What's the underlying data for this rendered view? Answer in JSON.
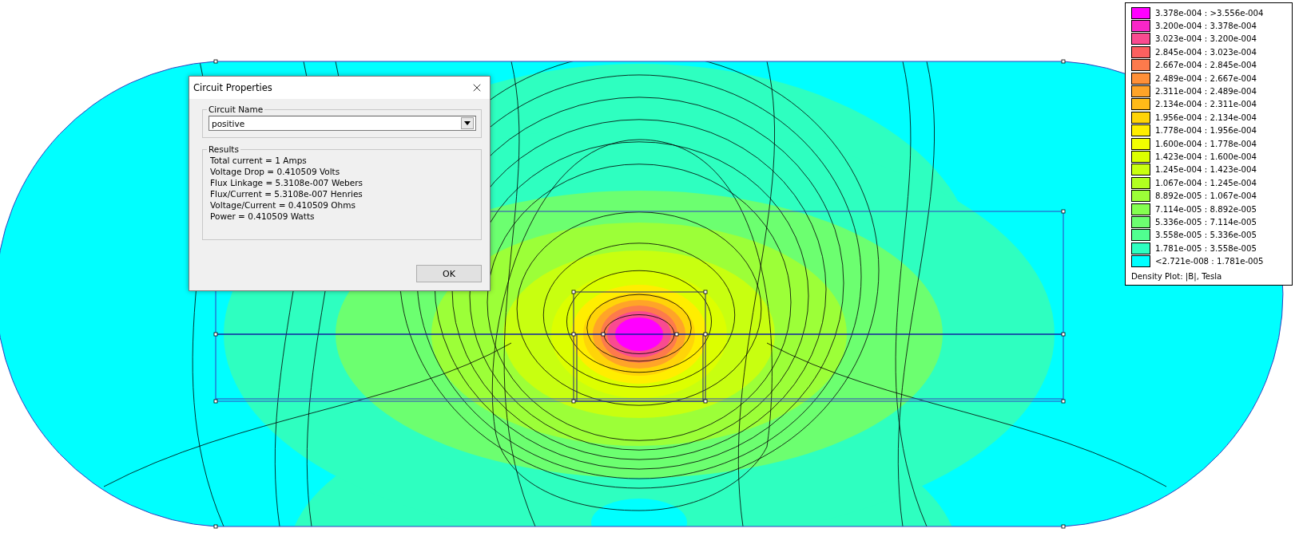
{
  "dialog": {
    "title": "Circuit Properties",
    "circuit_name_group": {
      "label": "Circuit Name",
      "value": "positive"
    },
    "results_group": {
      "label": "Results",
      "lines": [
        "Total current = 1 Amps",
        "Voltage Drop = 0.410509 Volts",
        "Flux Linkage = 5.3108e-007 Webers",
        "Flux/Current = 5.3108e-007 Henries",
        "Voltage/Current = 0.410509 Ohms",
        "Power = 0.410509 Watts"
      ]
    },
    "buttons": [
      "OK"
    ]
  },
  "legend": {
    "entries": [
      {
        "range": "3.378e-004 : >3.556e-004",
        "color": "#ff00ff"
      },
      {
        "range": "3.200e-004 : 3.378e-004",
        "color": "#f826c8"
      },
      {
        "range": "3.023e-004 : 3.200e-004",
        "color": "#f94b90"
      },
      {
        "range": "2.845e-004 : 3.023e-004",
        "color": "#fb6060"
      },
      {
        "range": "2.667e-004 : 2.845e-004",
        "color": "#fd7a4c"
      },
      {
        "range": "2.489e-004 : 2.667e-004",
        "color": "#ff9038"
      },
      {
        "range": "2.311e-004 : 2.489e-004",
        "color": "#ffa428"
      },
      {
        "range": "2.134e-004 : 2.311e-004",
        "color": "#ffba18"
      },
      {
        "range": "1.956e-004 : 2.134e-004",
        "color": "#ffd408"
      },
      {
        "range": "1.778e-004 : 1.956e-004",
        "color": "#ffee00"
      },
      {
        "range": "1.600e-004 : 1.778e-004",
        "color": "#f2ff00"
      },
      {
        "range": "1.423e-004 : 1.600e-004",
        "color": "#dcff00"
      },
      {
        "range": "1.245e-004 : 1.423e-004",
        "color": "#c8ff10"
      },
      {
        "range": "1.067e-004 : 1.245e-004",
        "color": "#b2ff20"
      },
      {
        "range": "8.892e-005 : 1.067e-004",
        "color": "#9cff38"
      },
      {
        "range": "7.114e-005 : 8.892e-005",
        "color": "#84ff50"
      },
      {
        "range": "5.336e-005 : 7.114e-005",
        "color": "#6cff70"
      },
      {
        "range": "3.558e-005 : 5.336e-005",
        "color": "#50ff90"
      },
      {
        "range": "1.781e-005 : 3.558e-005",
        "color": "#2effc0"
      },
      {
        "range": "<2.721e-008 : 1.781e-005",
        "color": "#00ffff"
      }
    ],
    "caption": "Density Plot: |B|, Tesla"
  }
}
